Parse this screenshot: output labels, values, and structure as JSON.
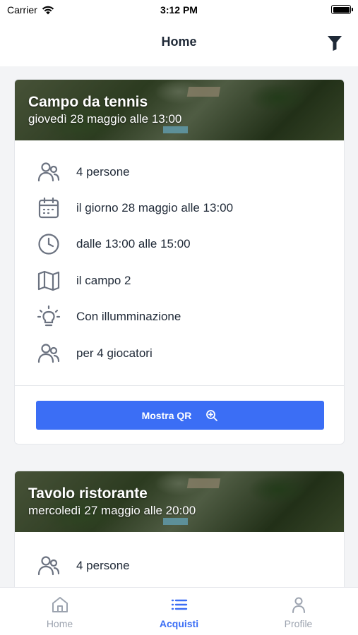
{
  "status_bar": {
    "carrier": "Carrier",
    "time": "3:12 PM"
  },
  "nav": {
    "title": "Home",
    "filter_icon": "filter-icon"
  },
  "colors": {
    "accent": "#3b6ef5",
    "icon_gray": "#6b7280",
    "text": "#1f2937",
    "inactive_tab": "#9ca3af"
  },
  "cards": [
    {
      "title": "Campo da tennis",
      "subtitle": "giovedì 28 maggio alle 13:00",
      "details": [
        {
          "icon": "users-icon",
          "text": "4 persone"
        },
        {
          "icon": "calendar-icon",
          "text": "il giorno 28 maggio alle 13:00"
        },
        {
          "icon": "clock-icon",
          "text": "dalle 13:00 alle 15:00"
        },
        {
          "icon": "map-icon",
          "text": "il campo 2"
        },
        {
          "icon": "lightbulb-icon",
          "text": "Con illumminazione"
        },
        {
          "icon": "users-icon",
          "text": "per 4 giocatori"
        }
      ],
      "button": {
        "label": "Mostra QR",
        "icon": "zoom-in-icon"
      }
    },
    {
      "title": "Tavolo ristorante",
      "subtitle": "mercoledì 27 maggio alle 20:00",
      "details": [
        {
          "icon": "users-icon",
          "text": "4 persone"
        }
      ]
    }
  ],
  "tabs": [
    {
      "label": "Home",
      "icon": "home-icon",
      "active": false
    },
    {
      "label": "Acquisti",
      "icon": "list-icon",
      "active": true
    },
    {
      "label": "Profile",
      "icon": "user-icon",
      "active": false
    }
  ]
}
